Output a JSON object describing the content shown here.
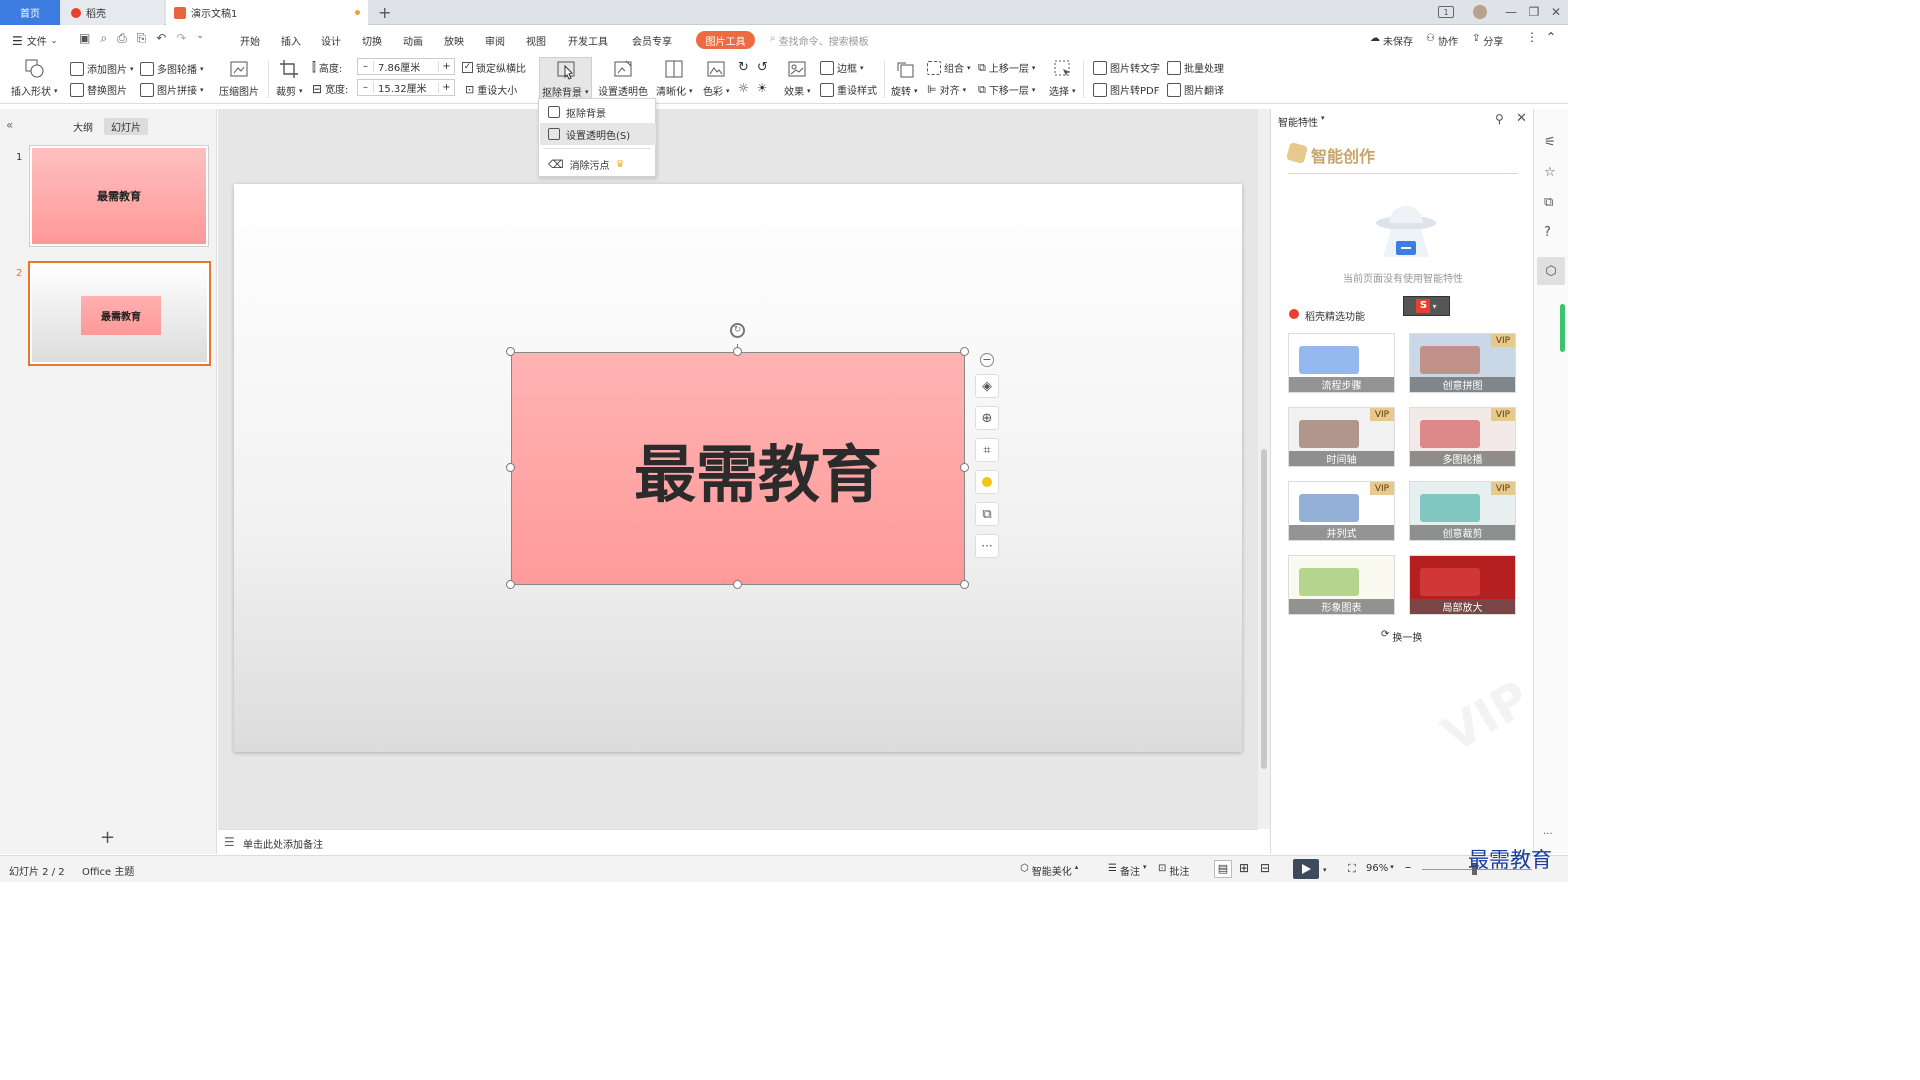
{
  "tabs": {
    "home": "首页",
    "daoke": "稻壳",
    "document": "演示文稿1",
    "add": "+"
  },
  "window_buttons": [
    "1",
    "—",
    "❐",
    "✕"
  ],
  "menu": {
    "file": "文件",
    "items": [
      "开始",
      "插入",
      "设计",
      "切换",
      "动画",
      "放映",
      "审阅",
      "视图",
      "开发工具",
      "会员专享"
    ],
    "active_tool": "图片工具",
    "search_placeholder": "查找命令、搜索模板",
    "unsaved": "未保存",
    "collab": "协作",
    "share": "分享"
  },
  "ribbon": {
    "insert_shape": "插入形状",
    "add_picture": "添加图片",
    "multi_carousel": "多图轮播",
    "replace_picture": "替换图片",
    "picture_collage": "图片拼接",
    "compress_picture": "压缩图片",
    "crop": "裁剪",
    "height_label": "高度:",
    "height_value": "7.86厘米",
    "width_label": "宽度:",
    "width_value": "15.32厘米",
    "lock_ratio": "锁定纵横比",
    "reset_size": "重设大小",
    "remove_bg": "抠除背景",
    "set_transparent": "设置透明色",
    "sharpen": "清晰化",
    "color": "色彩",
    "effect": "效果",
    "border": "边框",
    "reset_style": "重设样式",
    "rotate": "旋转",
    "group": "组合",
    "align": "对齐",
    "bring_forward": "上移一层",
    "send_backward": "下移一层",
    "select": "选择",
    "pic_to_text": "图片转文字",
    "batch_process": "批量处理",
    "pic_to_pdf": "图片转PDF",
    "pic_translate": "图片翻译"
  },
  "dropdown": [
    "抠除背景",
    "设置透明色(S)",
    "消除污点"
  ],
  "left_panel": {
    "tab_outline": "大纲",
    "tab_slides": "幻灯片",
    "slides": [
      {
        "num": "1",
        "text": "最需教育"
      },
      {
        "num": "2",
        "text": "最需教育"
      }
    ],
    "add": "+"
  },
  "slide": {
    "picture_text": "最需教育"
  },
  "notes_placeholder": "单击此处添加备注",
  "right_panel": {
    "header": "智能特性",
    "title": "智能创作",
    "empty_text": "当前页面没有使用智能特性",
    "section": "稻壳精选功能",
    "cards": [
      {
        "label": "流程步骤",
        "vip": false
      },
      {
        "label": "创意拼图",
        "vip": true
      },
      {
        "label": "时间轴",
        "vip": true
      },
      {
        "label": "多图轮播",
        "vip": true
      },
      {
        "label": "并列式",
        "vip": true
      },
      {
        "label": "创意裁剪",
        "vip": true
      },
      {
        "label": "形象图表",
        "vip": false
      },
      {
        "label": "局部放大",
        "vip": false
      }
    ],
    "vip_badge": "VIP",
    "refresh": "换一换"
  },
  "status": {
    "slide_count": "幻灯片 2 / 2",
    "theme": "Office 主题",
    "beautify": "智能美化",
    "notes": "备注",
    "comments": "批注",
    "zoom": "96%",
    "watermark": "最需教育"
  },
  "colors": {
    "accent": "#3d7de2",
    "tool_tab": "#ec6b41",
    "selection": "#e8772e",
    "vip": "#e8c98d"
  }
}
